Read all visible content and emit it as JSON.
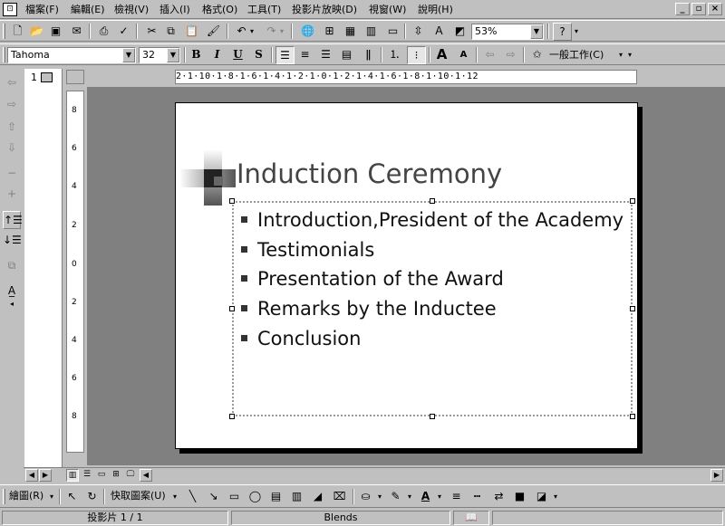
{
  "menubar": {
    "items": [
      {
        "label": "檔案(F)"
      },
      {
        "label": "編輯(E)"
      },
      {
        "label": "檢視(V)"
      },
      {
        "label": "插入(I)"
      },
      {
        "label": "格式(O)"
      },
      {
        "label": "工具(T)"
      },
      {
        "label": "投影片放映(D)"
      },
      {
        "label": "視窗(W)"
      },
      {
        "label": "說明(H)"
      }
    ]
  },
  "standard_toolbar": {
    "zoom": "53%",
    "help_icon": "?"
  },
  "formatting_toolbar": {
    "font": "Tahoma",
    "font_size": "32",
    "bold": "B",
    "italic": "I",
    "underline": "U",
    "shadow": "S",
    "common_tasks": "一般工作(C)"
  },
  "ruler": {
    "horizontal_label": "2·1·10·1·8·1·6·1·4·1·2·1·0·1·2·1·4·1·6·1·8·1·10·1·12",
    "vertical_marks": [
      "8",
      "6",
      "4",
      "2",
      "0",
      "2",
      "4",
      "6",
      "8"
    ]
  },
  "thumbnail": {
    "slide_number": "1"
  },
  "slide": {
    "title": "Induction Ceremony",
    "bullets": [
      "Introduction,President of the Academy",
      "Testimonials",
      "Presentation of the Award",
      "Remarks by the Inductee",
      "Conclusion"
    ]
  },
  "drawing_toolbar": {
    "draw_label": "繪圖(R)",
    "autoshapes_label": "快取圖案(U)"
  },
  "statusbar": {
    "slide_info": "投影片 1 / 1",
    "design": "Blends"
  },
  "colors": {
    "chrome": "#c0c0c0",
    "workspace": "#808080",
    "slide_background": "#ffffff",
    "title_text": "#444444"
  },
  "icons": [
    "powerpoint-app-icon",
    "new-icon",
    "open-icon",
    "save-icon",
    "print-icon",
    "spelling-icon",
    "cut-icon",
    "copy-icon",
    "paste-icon",
    "format-painter-icon",
    "undo-icon",
    "redo-icon",
    "hyperlink-icon",
    "table-icon",
    "chart-icon",
    "new-slide-icon",
    "grayscale-icon",
    "help-icon",
    "select-icon",
    "rotate-icon",
    "line-icon",
    "arrow-icon",
    "rectangle-icon",
    "oval-icon",
    "textbox-icon",
    "wordart-icon",
    "fill-color-icon",
    "line-color-icon",
    "font-color-icon",
    "shadow-icon",
    "3d-icon"
  ]
}
